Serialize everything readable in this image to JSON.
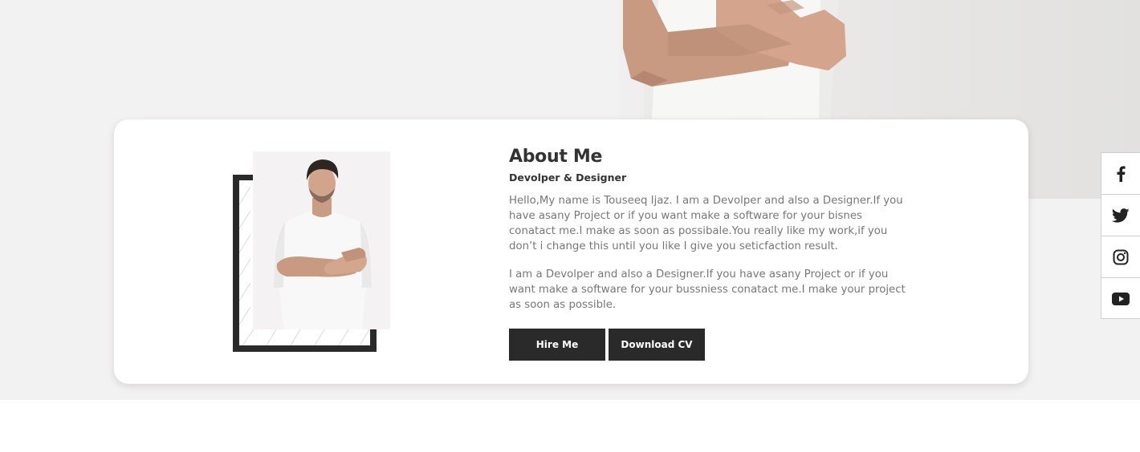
{
  "about": {
    "title": "About Me",
    "subtitle": "Devolper & Designer",
    "paragraph_1": "Hello,My name is Touseeq Ijaz. I am a Devolper and also a Designer.If you have asany Project or if you want make a software for your bisnes conatact me.I make as soon as possibale.You really like my work,if you don’t i change this until you like I give you seticfaction result.",
    "paragraph_2": "I am a Devolper and also a Designer.If you have asany Project or if you want make a software for your bussniess conatact me.I make your project as soon as possible."
  },
  "buttons": {
    "hire_label": "Hire Me",
    "cv_label": "Download CV"
  },
  "social": {
    "items": [
      {
        "icon": "facebook-icon"
      },
      {
        "icon": "twitter-icon"
      },
      {
        "icon": "instagram-icon"
      },
      {
        "icon": "youtube-icon"
      }
    ]
  },
  "colors": {
    "dark": "#2a2a2a",
    "text_muted": "#777777",
    "page_bg": "#f3f2f2"
  }
}
